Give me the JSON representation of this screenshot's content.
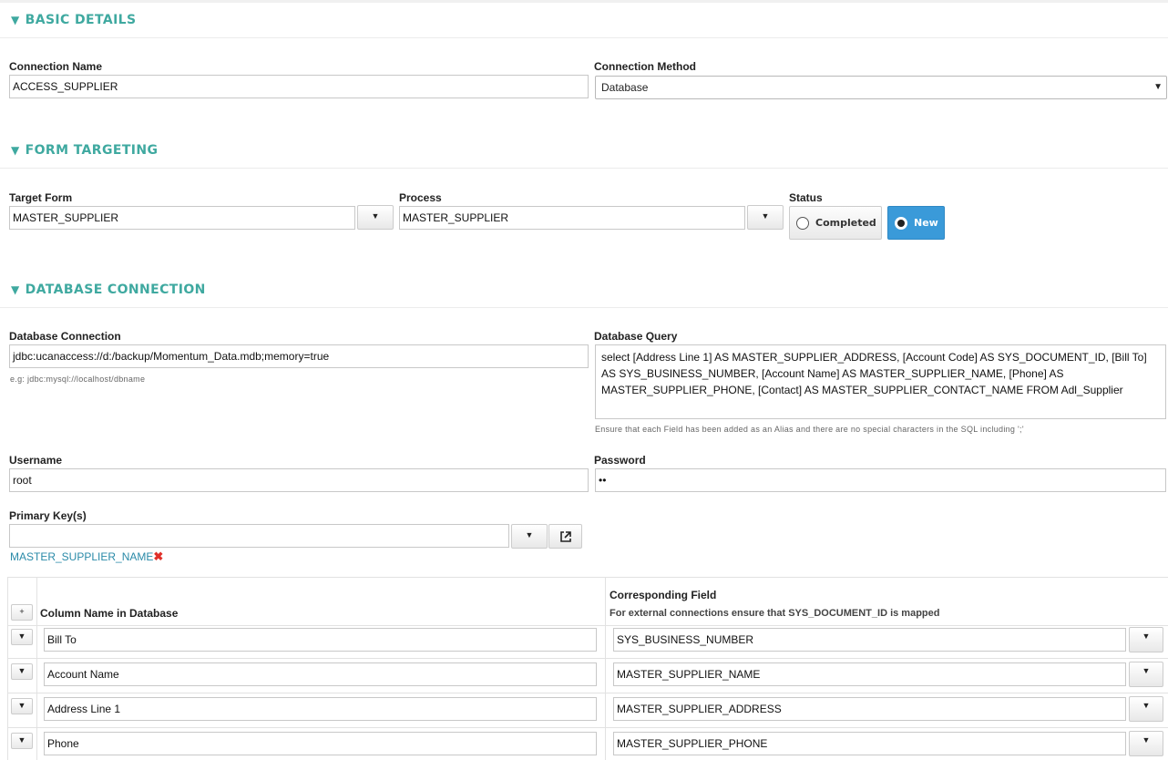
{
  "sections": {
    "basic": "BASIC DETAILS",
    "targeting": "FORM TARGETING",
    "database": "DATABASE CONNECTION"
  },
  "icons": {
    "collapse": "triangle-down-icon",
    "external": "external-link-icon",
    "remove": "remove-x-icon",
    "caret": "caret-down-icon"
  },
  "colors": {
    "accent": "#3fa9a0",
    "primary_button": "#3a9ad9",
    "link": "#2a8aa8",
    "danger": "#e0302a"
  },
  "basic": {
    "connection_name_label": "Connection Name",
    "connection_name_value": "ACCESS_SUPPLIER",
    "connection_method_label": "Connection Method",
    "connection_method_value": "Database"
  },
  "targeting": {
    "target_form_label": "Target Form",
    "target_form_value": "MASTER_SUPPLIER",
    "process_label": "Process",
    "process_value": "MASTER_SUPPLIER",
    "status_label": "Status",
    "status_completed": "Completed",
    "status_new": "New"
  },
  "database": {
    "connection_label": "Database Connection",
    "connection_value": "jdbc:ucanaccess://d:/backup/Momentum_Data.mdb;memory=true",
    "connection_hint": "e.g: jdbc:mysql://localhost/dbname",
    "query_label": "Database Query",
    "query_value": "select [Address Line 1]  AS MASTER_SUPPLIER_ADDRESS, [Account Code] AS SYS_DOCUMENT_ID, [Bill To] AS SYS_BUSINESS_NUMBER, [Account Name] AS MASTER_SUPPLIER_NAME, [Phone] AS MASTER_SUPPLIER_PHONE, [Contact] AS MASTER_SUPPLIER_CONTACT_NAME FROM Adl_Supplier",
    "query_hint": "Ensure that each Field has been added as an Alias and there are no special characters in the SQL including ';'",
    "username_label": "Username",
    "username_value": "root",
    "password_label": "Password",
    "password_value": "••",
    "primary_keys_label": "Primary Key(s)",
    "primary_keys_value": "",
    "primary_key_tag": "MASTER_SUPPLIER_NAME"
  },
  "mapping": {
    "add_label": "+",
    "col_header": "Column Name in Database",
    "field_header": "Corresponding Field",
    "field_subheader": "For external connections ensure that SYS_DOCUMENT_ID is mapped",
    "rows": [
      {
        "column": "Bill To",
        "field": "SYS_BUSINESS_NUMBER"
      },
      {
        "column": "Account Name",
        "field": "MASTER_SUPPLIER_NAME"
      },
      {
        "column": "Address Line 1",
        "field": "MASTER_SUPPLIER_ADDRESS"
      },
      {
        "column": "Phone",
        "field": "MASTER_SUPPLIER_PHONE"
      }
    ]
  }
}
